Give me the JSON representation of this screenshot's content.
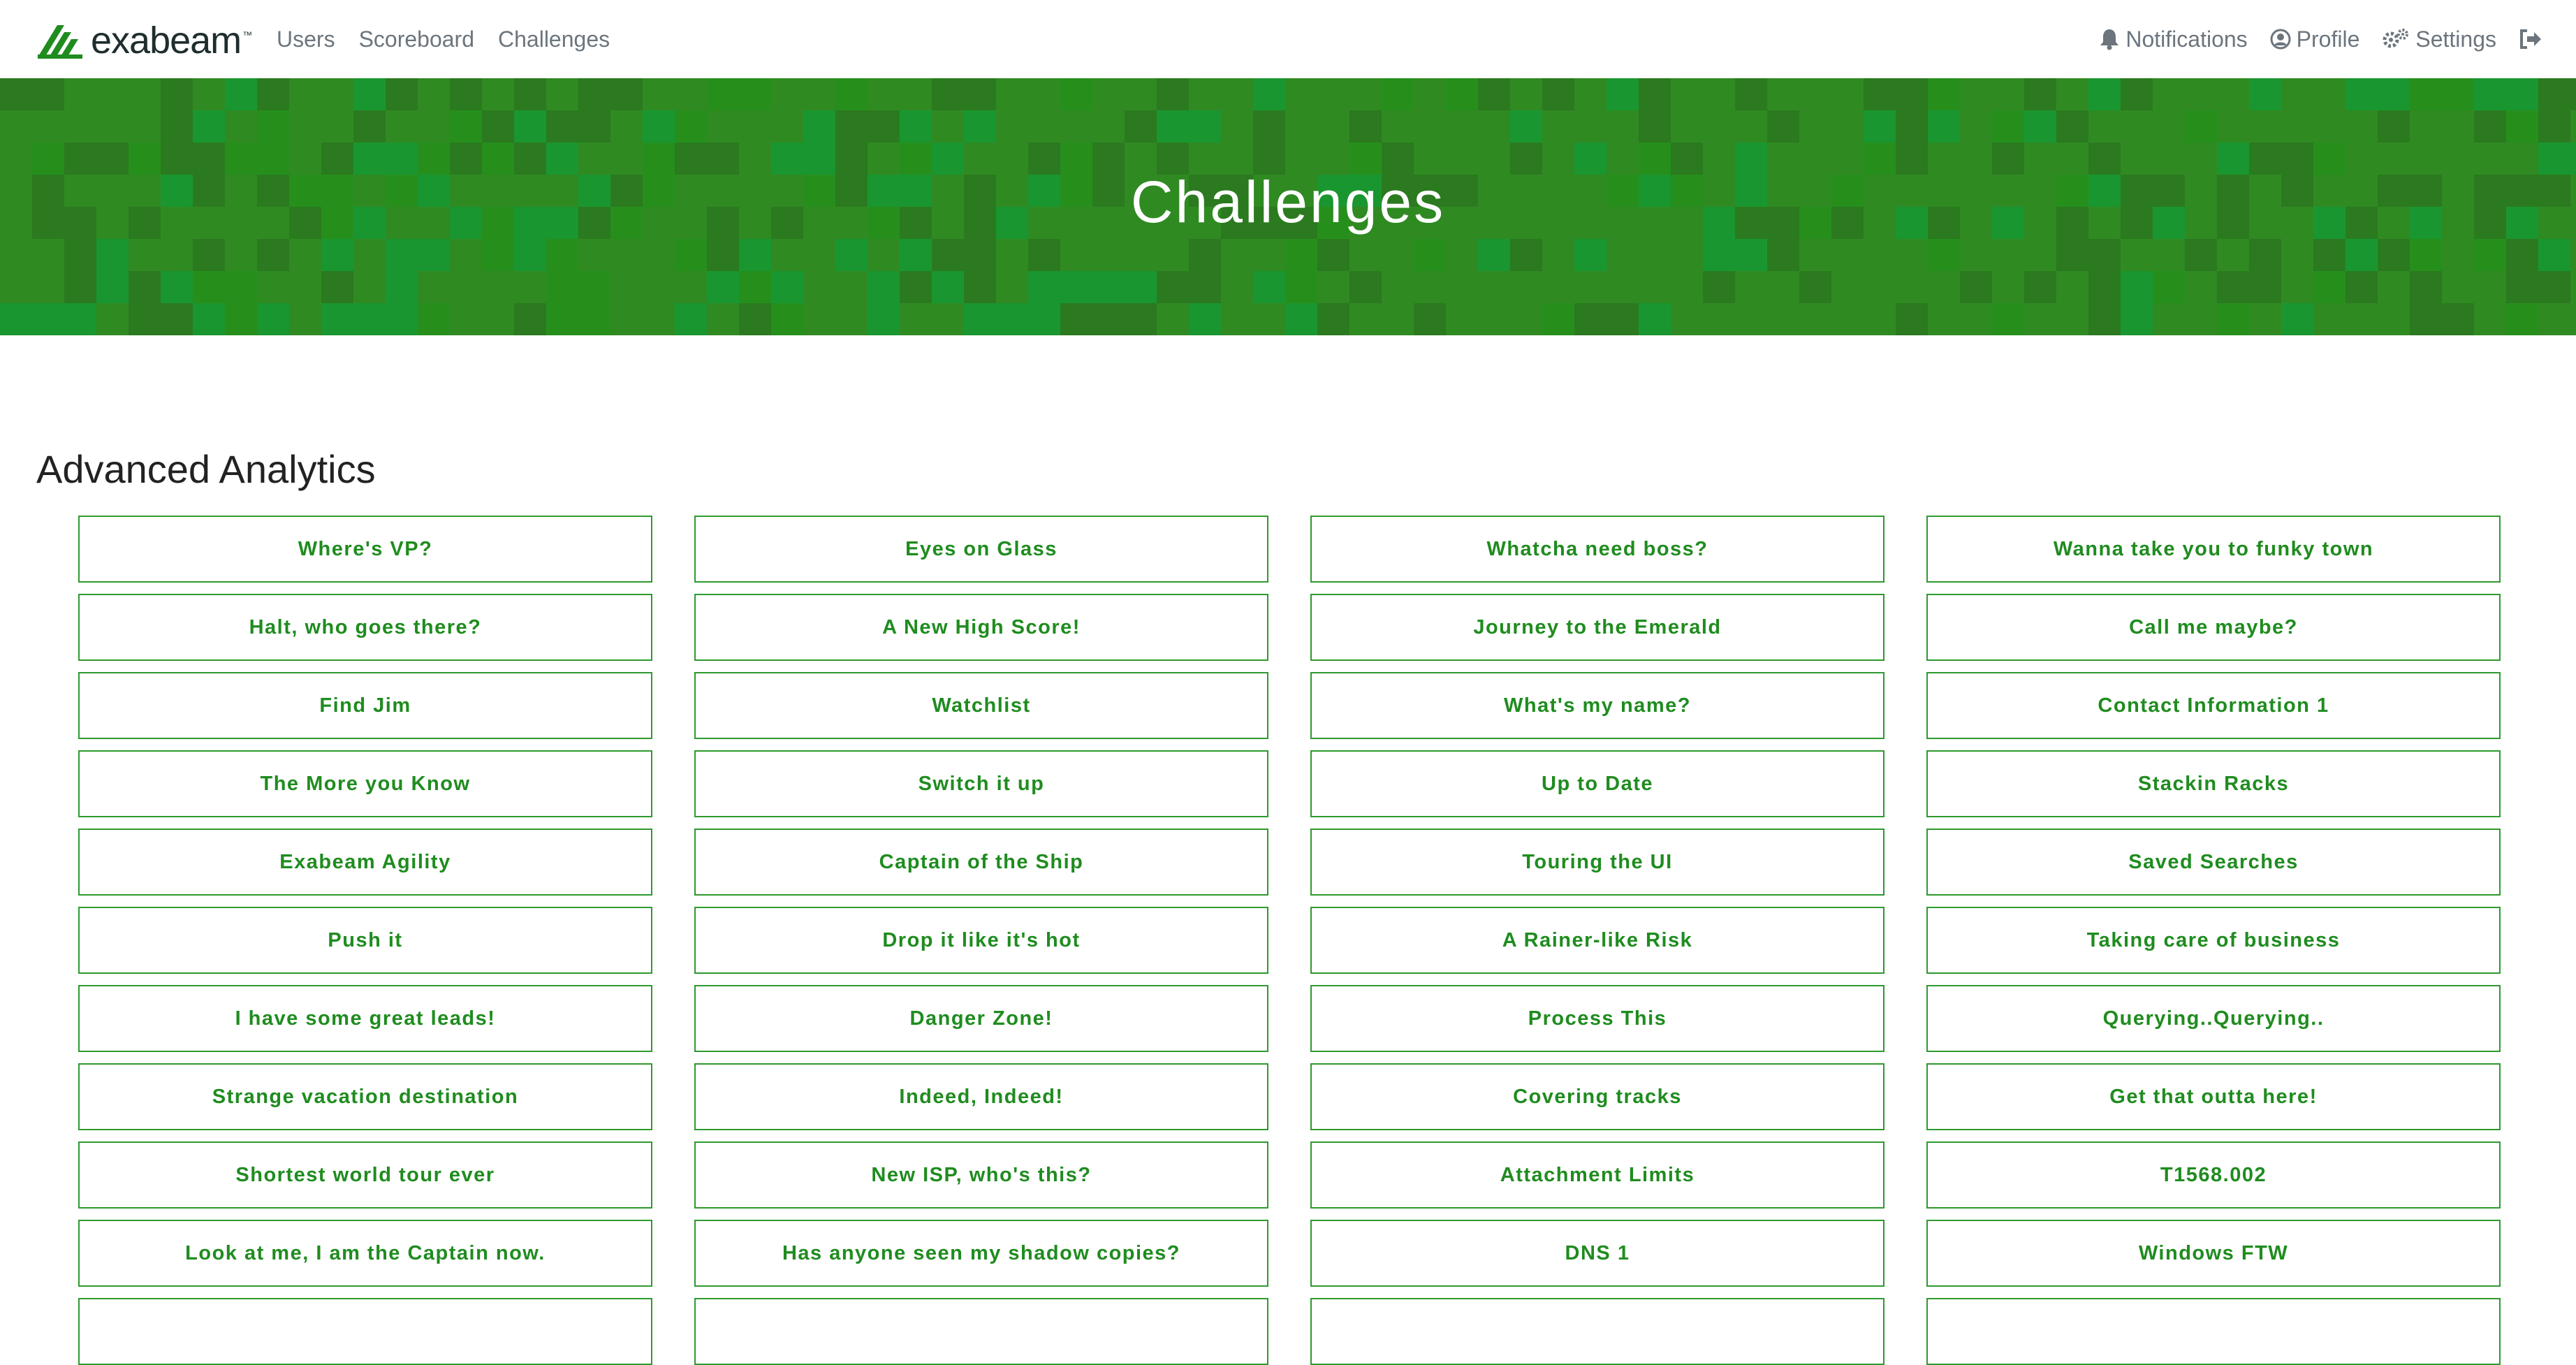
{
  "brand": {
    "name": "exabeam",
    "trademark": "™",
    "logo_color": "#1f8c1f"
  },
  "nav": {
    "left": [
      {
        "label": "Users"
      },
      {
        "label": "Scoreboard"
      },
      {
        "label": "Challenges"
      }
    ],
    "right": {
      "notifications": "Notifications",
      "profile": "Profile",
      "settings": "Settings"
    }
  },
  "hero": {
    "title": "Challenges",
    "colors": [
      "#2f8a22",
      "#2b7a1f",
      "#1a9630",
      "#268f1c"
    ]
  },
  "category": {
    "title": "Advanced Analytics"
  },
  "challenges": [
    [
      "Where's VP?",
      "Eyes on Glass",
      "Whatcha need boss?",
      "Wanna take you to funky town"
    ],
    [
      "Halt, who goes there?",
      "A New High Score!",
      "Journey to the Emerald",
      "Call me maybe?"
    ],
    [
      "Find Jim",
      "Watchlist",
      "What's my name?",
      "Contact Information 1"
    ],
    [
      "The More you Know",
      "Switch it up",
      "Up to Date",
      "Stackin Racks"
    ],
    [
      "Exabeam Agility",
      "Captain of the Ship",
      "Touring the UI",
      "Saved Searches"
    ],
    [
      "Push it",
      "Drop it like it's hot",
      "A Rainer-like Risk",
      "Taking care of business"
    ],
    [
      "I have some great leads!",
      "Danger Zone!",
      "Process This",
      "Querying..Querying.."
    ],
    [
      "Strange vacation destination",
      "Indeed, Indeed!",
      "Covering tracks",
      "Get that outta here!"
    ],
    [
      "Shortest world tour ever",
      "New ISP, who's this?",
      "Attachment Limits",
      "T1568.002"
    ],
    [
      "Look at me, I am the Captain now.",
      "Has anyone seen my shadow copies?",
      "DNS 1",
      "Windows FTW"
    ],
    [
      "",
      "",
      "",
      ""
    ]
  ],
  "accent_color": "#1f8c1f"
}
